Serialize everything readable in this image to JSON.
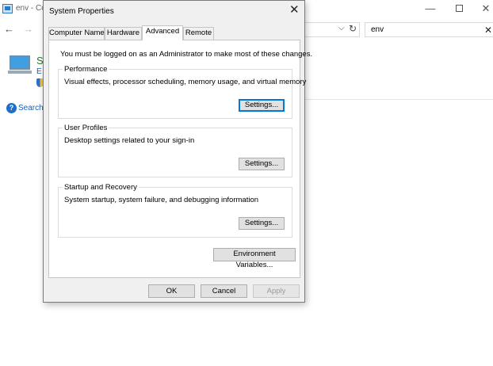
{
  "background_window": {
    "title": "env - Co",
    "min_glyph": "—",
    "close_glyph": "✕",
    "back_glyph": "←",
    "forward_glyph": "→",
    "dropdown_glyph": "⌵",
    "refresh_glyph": "↻",
    "search_value": "env",
    "clear_glyph": "✕",
    "side_letter_s": "S",
    "side_letter_e": "E",
    "help_glyph": "?",
    "help_link": "Search"
  },
  "dialog": {
    "title": "System Properties",
    "close_glyph": "✕",
    "tabs": [
      {
        "label": "Computer Name"
      },
      {
        "label": "Hardware"
      },
      {
        "label": "Advanced"
      },
      {
        "label": "Remote"
      }
    ],
    "selected_tab": "Advanced",
    "admin_note": "You must be logged on as an Administrator to make most of these changes.",
    "groups": {
      "performance": {
        "label": "Performance",
        "description": "Visual effects, processor scheduling, memory usage, and virtual memory",
        "button": "Settings..."
      },
      "user_profiles": {
        "label": "User Profiles",
        "description": "Desktop settings related to your sign-in",
        "button": "Settings..."
      },
      "startup_recovery": {
        "label": "Startup and Recovery",
        "description": "System startup, system failure, and debugging information",
        "button": "Settings..."
      }
    },
    "env_button": "Environment Variables...",
    "ok_button": "OK",
    "cancel_button": "Cancel",
    "apply_button": "Apply"
  },
  "colors": {
    "dialog_bg": "#f0f0f0",
    "focus_border": "#0078d7",
    "link": "#1a5fb4"
  }
}
